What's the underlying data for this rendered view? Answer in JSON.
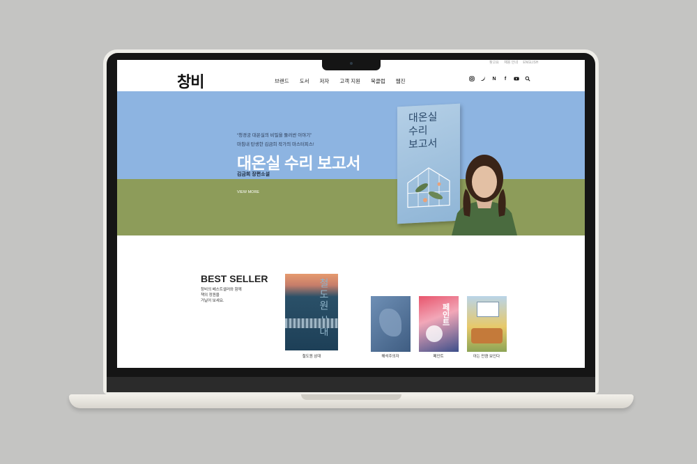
{
  "util_links": [
    "찾고요",
    "채용 안내",
    "ENGLISH"
  ],
  "logo": "창비",
  "nav": [
    "브랜드",
    "도서",
    "저자",
    "고객 지원",
    "북클럽",
    "웹진"
  ],
  "social_icons": [
    "instagram-icon",
    "twitter-icon",
    "naver-icon",
    "facebook-icon",
    "youtube-icon",
    "search-icon"
  ],
  "hero": {
    "quote": "“청경궁 대온실의 비밀을 둘러싼 이야기”",
    "sub": "마침내 탄생한 김금희 작가의 마스터피스!",
    "title": "대온실 수리 보고서",
    "author": "김금희 장편소설",
    "more": "VIEW MORE",
    "book_title_lines": [
      "대온실",
      "수리",
      "보고서"
    ],
    "colors": {
      "sky": "#8db4e1",
      "field": "#8d9c5a"
    }
  },
  "bestseller": {
    "title": "BEST SELLER",
    "desc_lines": [
      "창비의 베스트셀러와 함께",
      "책의 정원을",
      "거닐어 보세요."
    ],
    "books": [
      {
        "caption": "철도원 삼대",
        "cover_text": "철도원 삼대"
      },
      {
        "caption": "해석주의자",
        "cover_text": ""
      },
      {
        "caption": "페인트",
        "cover_text": "페인트"
      },
      {
        "caption": "아는 만큼 보인다",
        "cover_text": ""
      }
    ]
  }
}
